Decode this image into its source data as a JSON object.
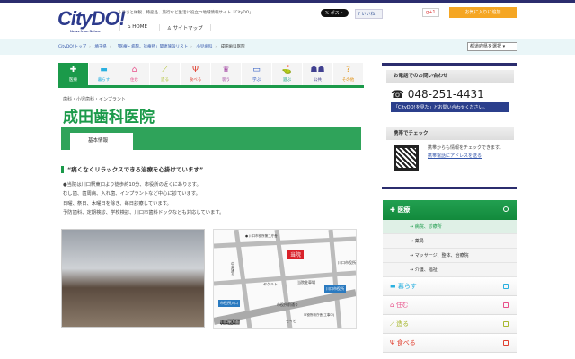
{
  "header": {
    "logo": "CityDO!",
    "logo_sub": "News from Scheo",
    "tagline": "ふるさと納税、特産品、旅行など生活に役立つ地域情報サイト「CityDO」",
    "nav": [
      "HOME",
      "サイトマップ"
    ],
    "x_post": "ポスト",
    "fb_like": "いいね！",
    "gplus": "+1",
    "favorite": "お気に入りに追加"
  },
  "breadcrumb": [
    "CityDO!トップ",
    "埼玉県",
    "「医療・病院、診療所」関連施設リスト",
    "小児歯科",
    "成田歯科医院"
  ],
  "pref_select": "都道府県を選択",
  "tabs": [
    {
      "label": "医療",
      "icon": "medical-icon",
      "color": "#1b9a4a"
    },
    {
      "label": "暮らす",
      "icon": "living-icon",
      "color": "#2ab0e0"
    },
    {
      "label": "住む",
      "icon": "house-icon",
      "color": "#e8508a"
    },
    {
      "label": "造る",
      "icon": "wrench-icon",
      "color": "#b0c030"
    },
    {
      "label": "食べる",
      "icon": "fork-icon",
      "color": "#e04030"
    },
    {
      "label": "装う",
      "icon": "dress-icon",
      "color": "#a040a0"
    },
    {
      "label": "学ぶ",
      "icon": "laptop-icon",
      "color": "#2050c0"
    },
    {
      "label": "遊ぶ",
      "icon": "golf-icon",
      "color": "#10a080"
    },
    {
      "label": "公共",
      "icon": "people-icon",
      "color": "#404090"
    },
    {
      "label": "その他",
      "icon": "question-icon",
      "color": "#e09010"
    }
  ],
  "clinic": {
    "category": "歯科・小児歯科・インプラント",
    "name": "成田歯科医院",
    "section_tab": "基本情報",
    "catch": "“痛くなくリラックスできる治療を心掛けています”",
    "body": [
      "●当院は川口駅東口より徒歩約10分、市役所の近くにあります。",
      "むし歯、歯周病、入れ歯、インプラントなど中心に診ています。",
      "日曜、祭日、木曜日を除き、毎日診療しています。",
      "予防歯科、定期検診、学校検診、川口市歯科ドックなども対応しています。"
    ]
  },
  "map": {
    "clinic": "当院",
    "labels": [
      "川口市役所第二庁舎",
      "中央通り",
      "ヤクルト",
      "当院駐車場",
      "川口市役所",
      "川口市役所",
      "市役所入口",
      "市役所前通り",
      "セイビ",
      "市役所新庁舎(工事中)",
      "川口駅方面"
    ]
  },
  "sidebar": {
    "phone_heading": "お電話でのお問い合わせ",
    "phone": "048-251-4431",
    "phone_note": "「CityDO!を見た」とお問い合わせください。",
    "mobile_heading": "携帯でチェック",
    "mobile_text": "携帯からも情報をチェックできます。",
    "mobile_link": "携帯電話にアドレスを送る"
  },
  "menu": {
    "head": "医療",
    "sub": [
      "病院、診療所",
      "薬局",
      "マッサージ、整体、治療院",
      "介護、福祉"
    ],
    "items": [
      {
        "label": "暮らす",
        "color": "#2ab0e0"
      },
      {
        "label": "住む",
        "color": "#e8508a"
      },
      {
        "label": "造る",
        "color": "#a8b830"
      },
      {
        "label": "食べる",
        "color": "#e04030"
      }
    ]
  }
}
